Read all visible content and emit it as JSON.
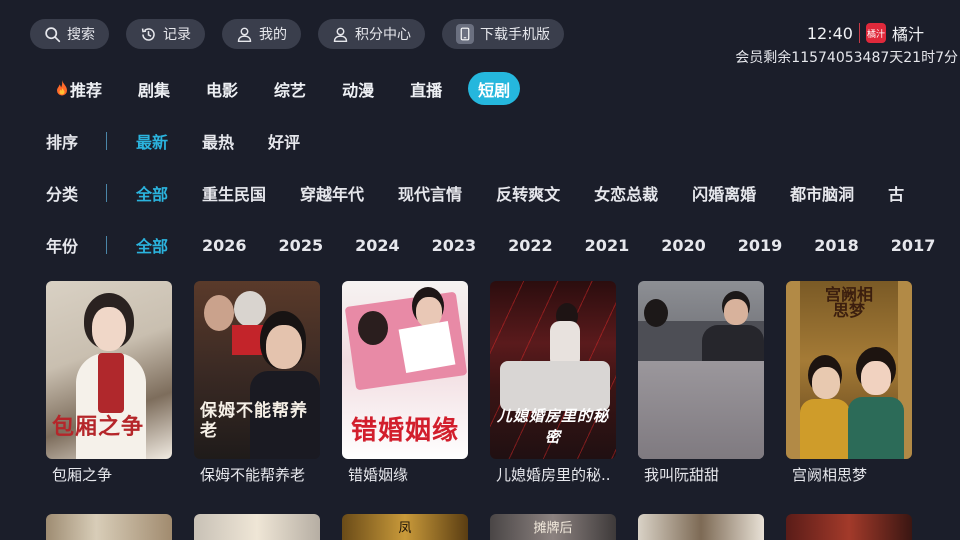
{
  "topbar": {
    "search": "搜索",
    "history": "记录",
    "mine": "我的",
    "points": "积分中心",
    "download": "下载手机版"
  },
  "status": {
    "clock": "12:40",
    "brand_name": "橘汁",
    "brand_logo_text": "橘汁",
    "vip_text": "会员剩余11574053487天21时7分"
  },
  "tabs": [
    {
      "label": "推荐"
    },
    {
      "label": "剧集"
    },
    {
      "label": "电影"
    },
    {
      "label": "综艺"
    },
    {
      "label": "动漫"
    },
    {
      "label": "直播"
    },
    {
      "label": "短剧"
    }
  ],
  "filters": {
    "sort": {
      "label": "排序",
      "options": [
        "最新",
        "最热",
        "好评"
      ]
    },
    "category": {
      "label": "分类",
      "options": [
        "全部",
        "重生民国",
        "穿越年代",
        "现代言情",
        "反转爽文",
        "女恋总裁",
        "闪婚离婚",
        "都市脑洞",
        "古"
      ]
    },
    "year": {
      "label": "年份",
      "options": [
        "全部",
        "2026",
        "2025",
        "2024",
        "2023",
        "2022",
        "2021",
        "2020",
        "2019",
        "2018",
        "2017"
      ]
    }
  },
  "cards": [
    {
      "title": "包厢之争",
      "poster_text": "包厢之争"
    },
    {
      "title": "保姆不能帮养老",
      "poster_text": "保姆不能帮养老"
    },
    {
      "title": "错婚姻缘",
      "poster_text": "错婚姻缘"
    },
    {
      "title": "儿媳婚房里的秘..",
      "poster_text": "儿媳婚房里的秘密"
    },
    {
      "title": "我叫阮甜甜",
      "poster_text": ""
    },
    {
      "title": "宫阙相思梦",
      "poster_text": "宫阙相思梦"
    }
  ],
  "row2_poster_texts": [
    "",
    "",
    "凤",
    "摊牌后",
    "",
    ""
  ],
  "colors": {
    "background": "#1b1e2a",
    "accent": "#25b7dd",
    "pill": "#3a3e4c",
    "brand": "#e0293b"
  },
  "icons": {
    "search": "search-icon",
    "history": "history-icon",
    "user": "user-icon",
    "points": "points-user-icon",
    "phone": "phone-icon",
    "fire": "fire-icon"
  }
}
